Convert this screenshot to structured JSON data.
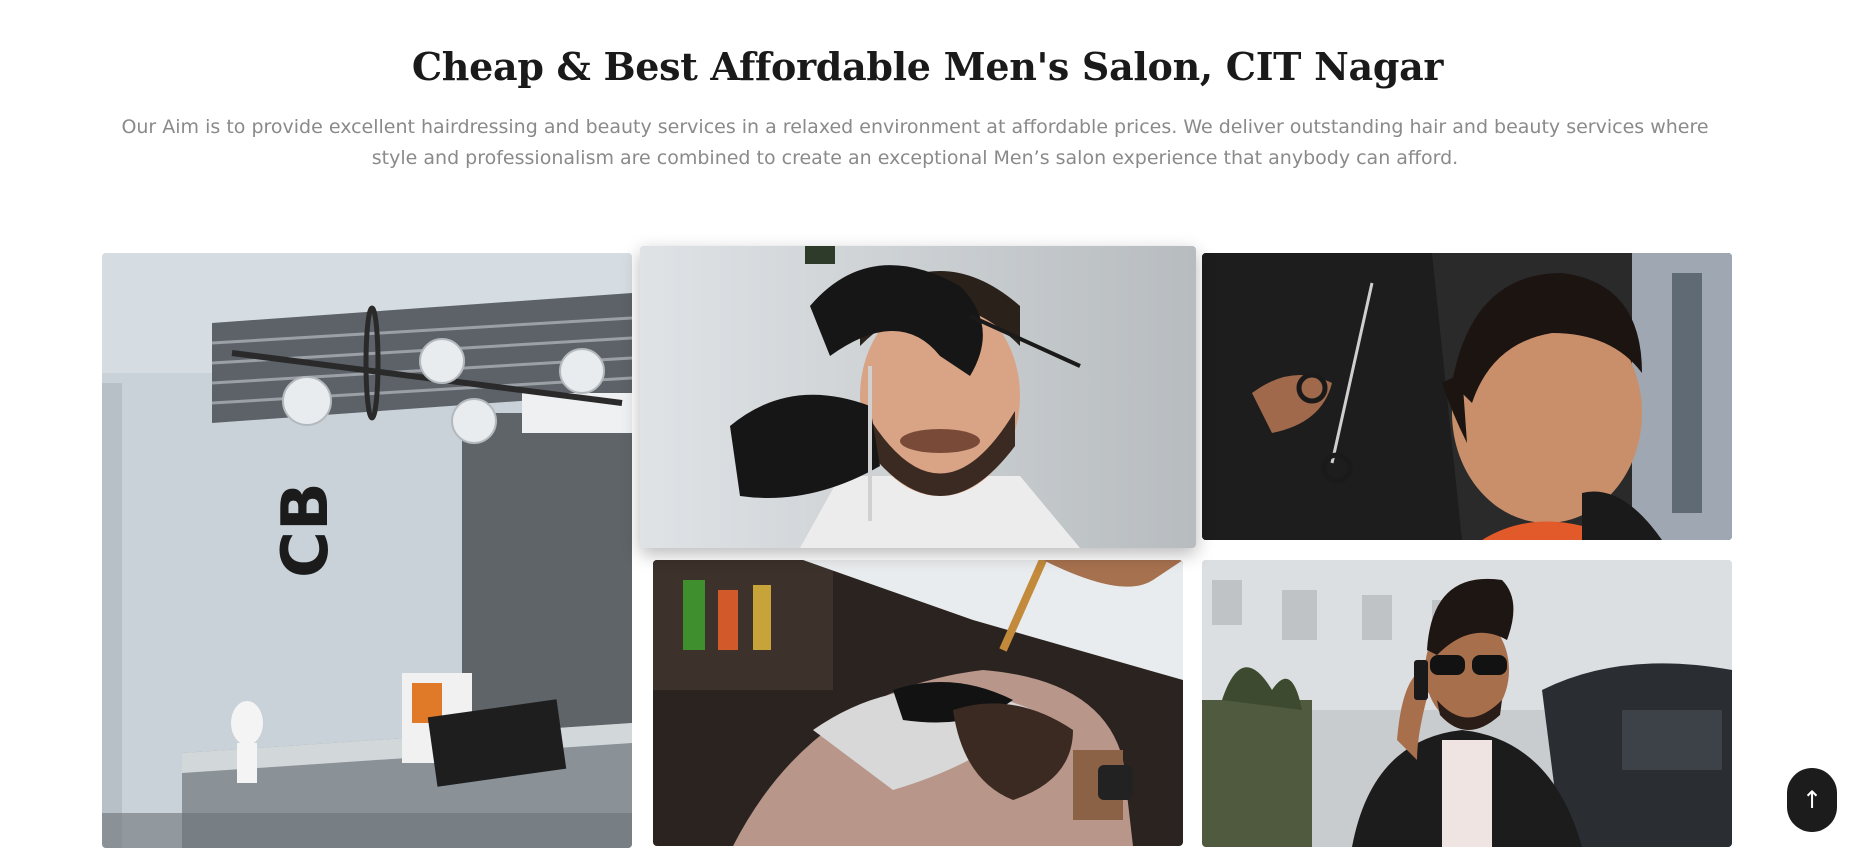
{
  "section": {
    "title": "Cheap & Best Affordable Men's Salon, CIT Nagar",
    "description": "Our Aim is to provide excellent hairdressing and beauty services in a relaxed environment at affordable prices. We deliver outstanding hair and beauty services where style and professionalism are combined to create an exceptional Men’s salon experience that anybody can afford."
  },
  "gallery": {
    "photos": [
      {
        "subject": "salon-reception-interior",
        "logo_text": "CB"
      },
      {
        "subject": "beard-trim-with-gloves"
      },
      {
        "subject": "boy-haircut-with-scissors"
      },
      {
        "subject": "beard-dye-application"
      },
      {
        "subject": "man-on-phone-sunglasses"
      }
    ]
  },
  "scroll_top": {
    "glyph": "↑",
    "icon": "arrow-up-icon"
  },
  "colors": {
    "title": "#1a1a1a",
    "text": "#8a8a8a",
    "button": "#1c1c1c"
  }
}
